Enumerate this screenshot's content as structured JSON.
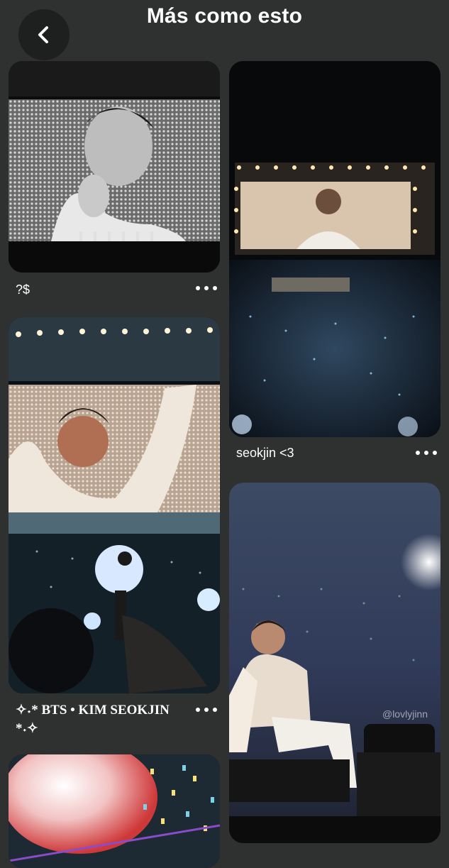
{
  "header": {
    "title": "Más como esto",
    "back_icon": "chevron-left-icon"
  },
  "pins": [
    {
      "title": "?$"
    },
    {
      "title": "seokjin <3"
    },
    {
      "title": "✧˖* BTS • KIM SEOKJIN *˖✧"
    },
    {
      "watermark": "@lovlyjinn"
    },
    {}
  ],
  "more_icon": "ellipsis-icon",
  "colors": {
    "background": "#2f3030",
    "back_button": "#1e1f1f",
    "text": "#ffffff"
  }
}
